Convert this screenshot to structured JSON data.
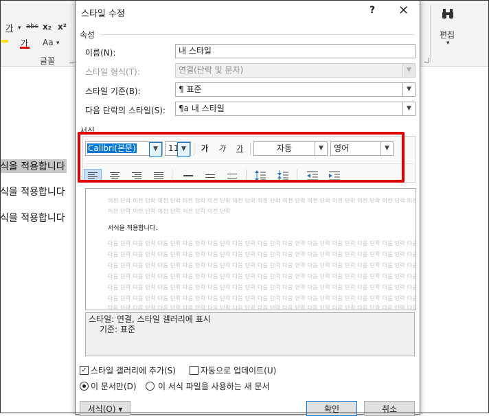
{
  "background": {
    "ribbon": {
      "font_group_label": "글꼴",
      "edit_label": "편집",
      "strike_label": "가",
      "strike2_label": "abc",
      "sub_label": "x₂",
      "sup_label": "x²",
      "fontcolor_label": "가",
      "case_label": "Aa"
    },
    "doc_lines": [
      "식을 적용합니다",
      "식을 적용합니다",
      "식을 적용합니다"
    ]
  },
  "dialog": {
    "title": "스타일 수정",
    "help": "?",
    "close": "✕",
    "properties_label": "속성",
    "name_label": "이름(N):",
    "name_value": "내 스타일",
    "style_type_label": "스타일 형식(T):",
    "style_type_value": "연결(단락 및 문자)",
    "based_on_label": "스타일 기준(B):",
    "based_on_value": "¶ 표준",
    "next_style_label": "다음 단락의 스타일(S):",
    "next_style_value": "¶a 내 스타일",
    "format_label": "서식",
    "font_name": "Calibri(본문)",
    "font_size": "11",
    "bold": "가",
    "italic": "가",
    "underline": "가",
    "color_value": "자동",
    "language_value": "영어",
    "preview_prev_line1": "이전 단락 이전 단락 이전 단락 이전 단락 이전 단락 이전 단락 이전 단락 이전 단락 이전 단락 이전 단락 이전 단락 이전 단락 이전 단락",
    "preview_prev_line2": "이전 단락 이전 단락 이전 단락 이전 단락 이전 단락",
    "preview_sample": "서식을 적용합니다.",
    "preview_next_line": "다음 단락 다음 단락 다음 단락 다음 단락 다음 단락 다음 단락 다음 단락 다음 단락 다음 단락 다음 단락 다음 단락 다음 단락 다음 단락",
    "desc_line1": "스타일: 연결, 스타일 갤러리에 표시",
    "desc_line2": "기준: 표준",
    "add_gallery_label": "스타일 갤러리에 추가(S)",
    "add_gallery_checked": true,
    "auto_update_label": "자동으로 업데이트(U)",
    "this_doc_label": "이 문서만(D)",
    "new_docs_label": "이 서식 파일을 사용하는 새 문서",
    "format_button": "서식(O) ▾",
    "ok_button": "확인",
    "cancel_button": "취소"
  }
}
